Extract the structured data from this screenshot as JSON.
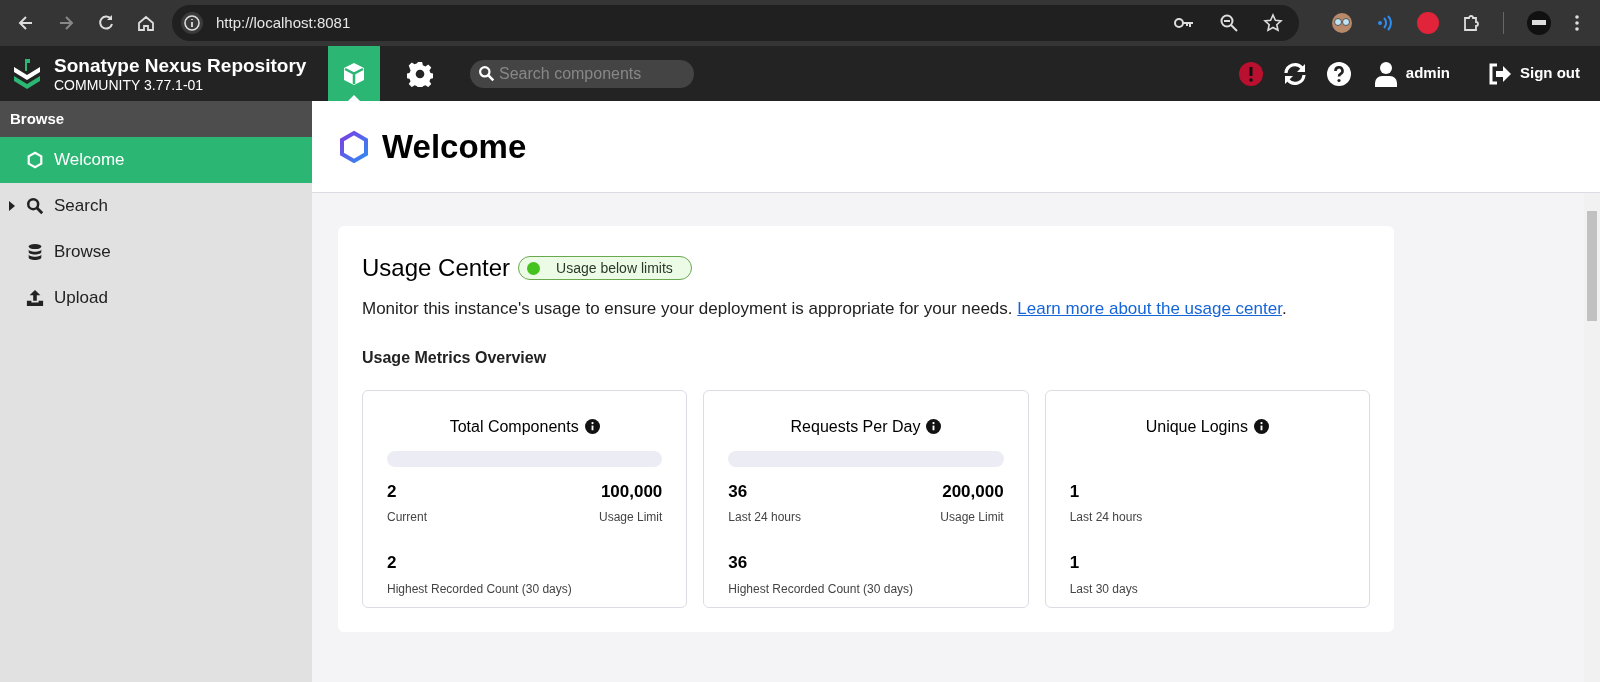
{
  "browser": {
    "url": "http://localhost:8081"
  },
  "header": {
    "product": "Sonatype Nexus Repository",
    "edition": "COMMUNITY 3.77.1-01",
    "modes": [
      {
        "kind": "browse",
        "selected": true
      },
      {
        "kind": "admin",
        "selected": false
      }
    ],
    "search": {
      "placeholder": "Search components"
    },
    "user": "admin",
    "sign_out": "Sign out"
  },
  "sidebar": {
    "title": "Browse",
    "items": [
      {
        "label": "Welcome",
        "kind": "hexagon",
        "selected": true,
        "expandable": false
      },
      {
        "label": "Search",
        "kind": "search",
        "selected": false,
        "expandable": true
      },
      {
        "label": "Browse",
        "kind": "database",
        "selected": false,
        "expandable": false
      },
      {
        "label": "Upload",
        "kind": "upload",
        "selected": false,
        "expandable": false
      }
    ]
  },
  "page": {
    "title": "Welcome"
  },
  "usage_center": {
    "title": "Usage Center",
    "status": "Usage below limits",
    "description": "Monitor this instance's usage to ensure your deployment is appropriate for your needs. ",
    "link": "Learn more about the usage center",
    "suffix": ".",
    "overview_title": "Usage Metrics Overview",
    "metrics": [
      {
        "title": "Total Components",
        "kind": "limit",
        "level": 2e-05,
        "primary": {
          "value": "2",
          "label": "Current"
        },
        "limit": {
          "value": "100,000",
          "label": "Usage Limit"
        },
        "secondary": {
          "value": "2",
          "label": "Highest Recorded Count (30 days)"
        }
      },
      {
        "title": "Requests Per Day",
        "kind": "limit",
        "level": 0.00018,
        "primary": {
          "value": "36",
          "label": "Last 24 hours"
        },
        "limit": {
          "value": "200,000",
          "label": "Usage Limit"
        },
        "secondary": {
          "value": "36",
          "label": "Highest Recorded Count (30 days)"
        }
      },
      {
        "title": "Unique Logins",
        "kind": "plain",
        "primary": {
          "value": "1",
          "label": "Last 24 hours"
        },
        "secondary": {
          "value": "1",
          "label": "Last 30 days"
        }
      }
    ]
  }
}
